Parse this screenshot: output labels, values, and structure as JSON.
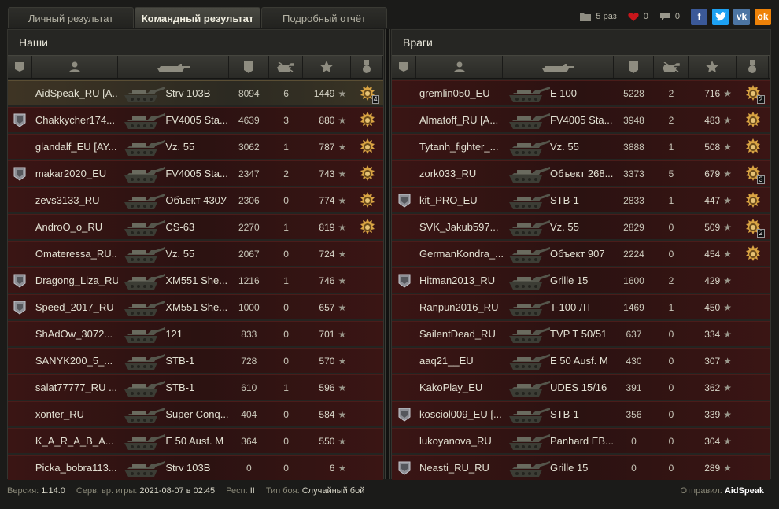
{
  "tabs": [
    "Личный результат",
    "Командный результат",
    "Подробный отчёт"
  ],
  "active_tab": 1,
  "social": {
    "views": "5 раз",
    "likes": "0",
    "comments": "0",
    "buttons": [
      "f",
      "t",
      "vk",
      "ok"
    ]
  },
  "teams": {
    "left": {
      "title": "Наши",
      "rows": [
        {
          "badge": false,
          "name": "AidSpeak_RU [A...",
          "tank": "Strv 103B",
          "dmg": "8094",
          "kills": "6",
          "xp": "1449",
          "medal": true,
          "medal_count": "4",
          "me": true
        },
        {
          "badge": true,
          "name": "Chakkycher174...",
          "tank": "FV4005 Sta...",
          "dmg": "4639",
          "kills": "3",
          "xp": "880",
          "medal": true,
          "medal_count": ""
        },
        {
          "badge": false,
          "name": "glandalf_EU [AY...",
          "tank": "Vz. 55",
          "dmg": "3062",
          "kills": "1",
          "xp": "787",
          "medal": true,
          "medal_count": ""
        },
        {
          "badge": true,
          "name": "makar2020_EU",
          "tank": "FV4005 Sta...",
          "dmg": "2347",
          "kills": "2",
          "xp": "743",
          "medal": true,
          "medal_count": ""
        },
        {
          "badge": false,
          "name": "zevs3133_RU",
          "tank": "Объект 430У",
          "dmg": "2306",
          "kills": "0",
          "xp": "774",
          "medal": true,
          "medal_count": ""
        },
        {
          "badge": false,
          "name": "AndroO_o_RU",
          "tank": "CS-63",
          "dmg": "2270",
          "kills": "1",
          "xp": "819",
          "medal": true,
          "medal_count": ""
        },
        {
          "badge": false,
          "name": "Omateressa_RU...",
          "tank": "Vz. 55",
          "dmg": "2067",
          "kills": "0",
          "xp": "724",
          "medal": false,
          "medal_count": ""
        },
        {
          "badge": true,
          "name": "Dragong_Liza_RU",
          "tank": "XM551 She...",
          "dmg": "1216",
          "kills": "1",
          "xp": "746",
          "medal": false,
          "medal_count": ""
        },
        {
          "badge": true,
          "name": "Speed_2017_RU",
          "tank": "XM551 She...",
          "dmg": "1000",
          "kills": "0",
          "xp": "657",
          "medal": false,
          "medal_count": ""
        },
        {
          "badge": false,
          "name": "ShAdOw_3072...",
          "tank": "121",
          "dmg": "833",
          "kills": "0",
          "xp": "701",
          "medal": false,
          "medal_count": ""
        },
        {
          "badge": false,
          "name": "SANYK200_5_...",
          "tank": "STB-1",
          "dmg": "728",
          "kills": "0",
          "xp": "570",
          "medal": false,
          "medal_count": ""
        },
        {
          "badge": false,
          "name": "salat77777_RU ...",
          "tank": "STB-1",
          "dmg": "610",
          "kills": "1",
          "xp": "596",
          "medal": false,
          "medal_count": ""
        },
        {
          "badge": false,
          "name": "xonter_RU",
          "tank": "Super Conq...",
          "dmg": "404",
          "kills": "0",
          "xp": "584",
          "medal": false,
          "medal_count": ""
        },
        {
          "badge": false,
          "name": "K_A_R_A_B_A...",
          "tank": "E 50 Ausf. M",
          "dmg": "364",
          "kills": "0",
          "xp": "550",
          "medal": false,
          "medal_count": ""
        },
        {
          "badge": false,
          "name": "Picka_bobra113...",
          "tank": "Strv 103B",
          "dmg": "0",
          "kills": "0",
          "xp": "6",
          "medal": false,
          "medal_count": ""
        }
      ]
    },
    "right": {
      "title": "Враги",
      "rows": [
        {
          "badge": false,
          "name": "gremlin050_EU",
          "tank": "E 100",
          "dmg": "5228",
          "kills": "2",
          "xp": "716",
          "medal": true,
          "medal_count": "2"
        },
        {
          "badge": false,
          "name": "Almatoff_RU [A...",
          "tank": "FV4005 Sta...",
          "dmg": "3948",
          "kills": "2",
          "xp": "483",
          "medal": true,
          "medal_count": ""
        },
        {
          "badge": false,
          "name": "Tytanh_fighter_...",
          "tank": "Vz. 55",
          "dmg": "3888",
          "kills": "1",
          "xp": "508",
          "medal": true,
          "medal_count": ""
        },
        {
          "badge": false,
          "name": "zork033_RU",
          "tank": "Объект 268...",
          "dmg": "3373",
          "kills": "5",
          "xp": "679",
          "medal": true,
          "medal_count": "3"
        },
        {
          "badge": true,
          "name": "kit_PRO_EU",
          "tank": "STB-1",
          "dmg": "2833",
          "kills": "1",
          "xp": "447",
          "medal": true,
          "medal_count": ""
        },
        {
          "badge": false,
          "name": "SVK_Jakub597...",
          "tank": "Vz. 55",
          "dmg": "2829",
          "kills": "0",
          "xp": "509",
          "medal": true,
          "medal_count": "2"
        },
        {
          "badge": false,
          "name": "GermanKondra_...",
          "tank": "Объект 907",
          "dmg": "2224",
          "kills": "0",
          "xp": "454",
          "medal": true,
          "medal_count": ""
        },
        {
          "badge": true,
          "name": "Hitman2013_RU",
          "tank": "Grille 15",
          "dmg": "1600",
          "kills": "2",
          "xp": "429",
          "medal": false,
          "medal_count": ""
        },
        {
          "badge": false,
          "name": "Ranpun2016_RU",
          "tank": "T-100 ЛТ",
          "dmg": "1469",
          "kills": "1",
          "xp": "450",
          "medal": false,
          "medal_count": ""
        },
        {
          "badge": false,
          "name": "SailentDead_RU",
          "tank": "TVP T 50/51",
          "dmg": "637",
          "kills": "0",
          "xp": "334",
          "medal": false,
          "medal_count": ""
        },
        {
          "badge": false,
          "name": "aaq21__EU",
          "tank": "E 50 Ausf. M",
          "dmg": "430",
          "kills": "0",
          "xp": "307",
          "medal": false,
          "medal_count": ""
        },
        {
          "badge": false,
          "name": "KakoPlay_EU",
          "tank": "UDES 15/16",
          "dmg": "391",
          "kills": "0",
          "xp": "362",
          "medal": false,
          "medal_count": ""
        },
        {
          "badge": true,
          "name": "kosciol009_EU [...",
          "tank": "STB-1",
          "dmg": "356",
          "kills": "0",
          "xp": "339",
          "medal": false,
          "medal_count": ""
        },
        {
          "badge": false,
          "name": "lukoyanova_RU",
          "tank": "Panhard EB...",
          "dmg": "0",
          "kills": "0",
          "xp": "304",
          "medal": false,
          "medal_count": ""
        },
        {
          "badge": true,
          "name": "Neasti_RU_RU",
          "tank": "Grille 15",
          "dmg": "0",
          "kills": "0",
          "xp": "289",
          "medal": false,
          "medal_count": ""
        }
      ]
    }
  },
  "footer": {
    "version_label": "Версия:",
    "version": "1.14.0",
    "server_label": "Серв. вр. игры:",
    "server_time": "2021-08-07 в 02:45",
    "resp_label": "Респ:",
    "resp": "II",
    "battle_label": "Тип боя:",
    "battle_type": "Случайный бой",
    "sender_label": "Отправил:",
    "sender": "AidSpeak"
  },
  "colors": {
    "row_red": "#2b1211",
    "row_me": "#3e3424",
    "panel": "#242421"
  }
}
